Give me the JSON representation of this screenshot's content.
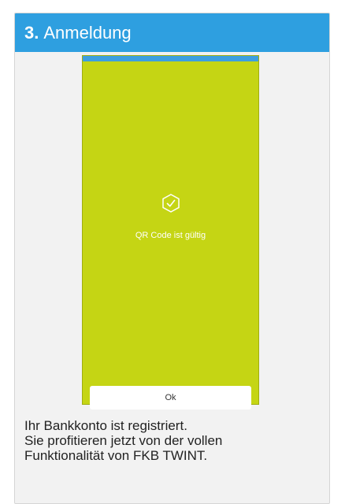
{
  "header": {
    "step_number": "3.",
    "title": "Anmeldung"
  },
  "phone": {
    "status_text": "QR Code ist gültig",
    "ok_label": "Ok",
    "icon": "shield-check-icon",
    "colors": {
      "screen_bg": "#c5d514",
      "top_bar": "#3d9fe0"
    }
  },
  "description": {
    "line1": "Ihr Bankkonto ist registriert.",
    "line2": "Sie profitieren jetzt von der vollen",
    "line3": "Funktionalität von FKB TWINT."
  },
  "colors": {
    "header_bg": "#2e9fe0"
  }
}
